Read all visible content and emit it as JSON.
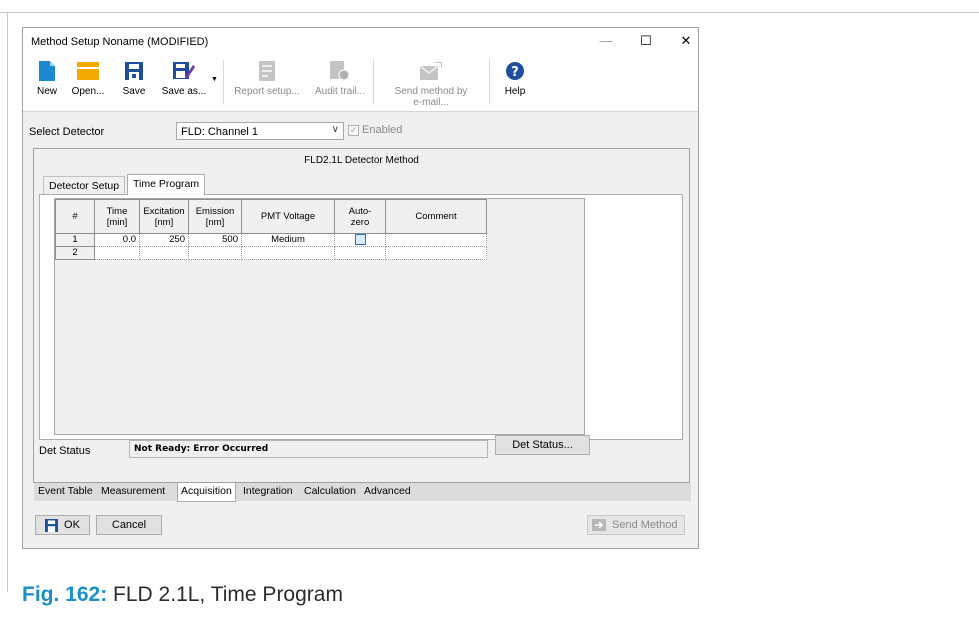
{
  "window": {
    "title": "Method Setup Noname (MODIFIED)",
    "controls": {
      "minimize": "—",
      "maximize": "☐",
      "close": "✕"
    }
  },
  "toolbar": {
    "new": "New",
    "open": "Open...",
    "save": "Save",
    "save_as": "Save as...",
    "report_setup": "Report setup...",
    "audit_trail": "Audit trail...",
    "send_method_line1": "Send method by",
    "send_method_line2": "e-mail...",
    "help": "Help"
  },
  "detector": {
    "label": "Select Detector",
    "selected": "FLD: Channel 1",
    "enabled_label": "Enabled",
    "enabled_checked": true
  },
  "method": {
    "title": "FLD2.1L Detector Method",
    "tabs": [
      "Detector Setup",
      "Time Program"
    ],
    "active_tab": "Time Program"
  },
  "time_program": {
    "columns": [
      "#",
      "Time [min]",
      "Excitation [nm]",
      "Emission [nm]",
      "PMT Voltage",
      "Auto-zero",
      "Comment"
    ],
    "column_lines": [
      [
        "#"
      ],
      [
        "Time",
        "[min]"
      ],
      [
        "Excitation",
        "[nm]"
      ],
      [
        "Emission",
        "[nm]"
      ],
      [
        "PMT Voltage"
      ],
      [
        "Auto-",
        "zero"
      ],
      [
        "Comment"
      ]
    ],
    "rows": [
      {
        "num": "1",
        "time": "0.0",
        "excitation": "250",
        "emission": "500",
        "pmt": "Medium",
        "autozero": false,
        "comment": ""
      },
      {
        "num": "2",
        "time": "",
        "excitation": "",
        "emission": "",
        "pmt": "",
        "autozero": null,
        "comment": ""
      }
    ]
  },
  "det_status": {
    "label": "Det Status",
    "value": "Not Ready: Error Occurred",
    "button": "Det Status..."
  },
  "bottom_tabs": [
    "Event Table",
    "Measurement",
    "Acquisition",
    "Integration",
    "Calculation",
    "Advanced"
  ],
  "active_bottom_tab": "Acquisition",
  "buttons": {
    "ok": "OK",
    "cancel": "Cancel",
    "send_method": "Send Method"
  },
  "caption": {
    "label": "Fig. 162:",
    "text": "FLD 2.1L, Time Program"
  },
  "colors": {
    "accent": "#1a8fc8",
    "folder": "#f2a900",
    "save_icon": "#1f4e9c",
    "help_icon": "#1f4e9c"
  }
}
